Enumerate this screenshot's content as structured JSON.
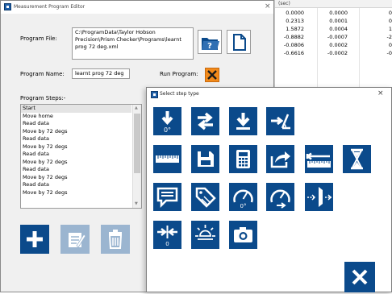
{
  "background_grid": {
    "header": "(sec)",
    "rows": [
      [
        "0.0000",
        "0.0000",
        "0"
      ],
      [
        "0.2313",
        "0.0001",
        "0"
      ],
      [
        "1.5872",
        "0.0004",
        "1"
      ],
      [
        "-0.8882",
        "-0.0007",
        "-2"
      ],
      [
        "-0.0806",
        "0.0002",
        "0"
      ],
      [
        "-0.6616",
        "-0.0002",
        "-0"
      ]
    ]
  },
  "editor": {
    "title": "Measurement Program Editor",
    "close_glyph": "×",
    "program_file_label": "Program File:",
    "program_file_value": "C:\\ProgramData\\Taylor Hobson Precision\\Prism Checker\\Programs\\learnt prog 72 deg.xml",
    "program_name_label": "Program Name:",
    "program_name_value": "learnt prog 72 deg",
    "run_program_label": "Run Program:",
    "program_steps_label": "Program Steps:-",
    "steps": [
      "Start",
      "Move home",
      "Read data",
      "Move by 72 degs",
      "Read data",
      "Move by 72 degs",
      "Read data",
      "Move by 72 degs",
      "Read data",
      "Move by 72 degs",
      "Read data",
      "Move by 72 degs"
    ]
  },
  "dialog": {
    "title": "Select step type",
    "close_glyph": "×",
    "tiles": {
      "rotate_zero_caption": "0°",
      "gauge_zero_caption": "0°",
      "converge_caption": "0"
    }
  },
  "colors": {
    "tile_blue": "#0b4a8b",
    "disabled_blue": "#9bb5d0",
    "run_orange": "#f28a1a"
  }
}
